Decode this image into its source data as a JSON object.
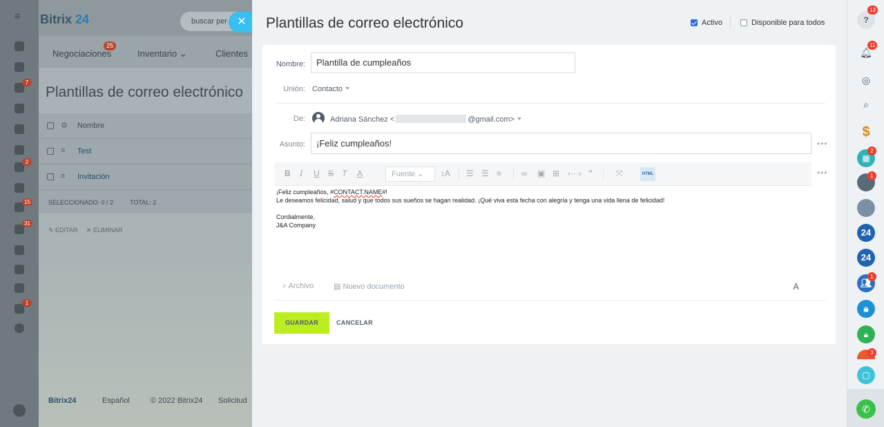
{
  "background": {
    "logo_main": "Bitrix",
    "logo_num": "24",
    "search_placeholder": "buscar per",
    "menu": {
      "deals": "Negociaciones",
      "deals_badge": "25",
      "inventory": "Inventario",
      "clients": "Clientes"
    },
    "title": "Plantillas de correo electrónico",
    "list_header": "Nombre",
    "rows": [
      "Test",
      "Invitación"
    ],
    "selected": "SELECCIONADO: 0 / 2",
    "total": "TOTAL: 2",
    "edit": "EDITAR",
    "delete": "ELIMINAR",
    "footer_brand": "Bitrix24",
    "footer_lang": "Español",
    "footer_copy": "© 2022 Bitrix24",
    "footer_link": "Solicitud",
    "left_badges": [
      "7",
      "2",
      "15",
      "31",
      "1"
    ]
  },
  "panel": {
    "title": "Plantillas de correo electrónico",
    "active_label": "Activo",
    "active_checked": true,
    "available_label": "Disponible para todos",
    "available_checked": false,
    "name_label": "Nombre:",
    "name_value": "Plantilla de cumpleaños",
    "union_label": "Unión:",
    "union_value": "Contacto",
    "from_label": "De:",
    "from_name": "Adriana Sánchez <",
    "from_domain": "@gmail.com>",
    "subject_label": "Asunto:",
    "subject_value": "¡Feliz cumpleaños!",
    "toolbar": {
      "font_label": "Fuente",
      "html_label": "HTML"
    },
    "body": {
      "line1_pre": "¡Feliz cumpleaños, #",
      "line1_var": "CONTACT.NAME",
      "line1_post": "#!",
      "line2": "Le deseamos felicidad, salud y que todos sus sueños se hagan realidad. ¡Qué viva esta fecha con alegría y tenga una vida llena de felicidad!",
      "line3": "Cordialmente,",
      "line4": "J&A Company"
    },
    "attach_label": "Archivo",
    "newdoc_label": "Nuevo documento",
    "save_label": "GUARDAR",
    "cancel_label": "CANCELAR"
  },
  "rail": {
    "help_badge": "13",
    "bell_badge": "11",
    "cal_badge": "2",
    "avatar_badge": "1",
    "group_badge": "1",
    "bottom_badge": "3",
    "b24_label": "24"
  },
  "colors": {
    "accent_green": "#bbed21",
    "brand_blue": "#1f63b0",
    "badge_red": "#ef3b2c",
    "close_cyan": "#36bff0"
  }
}
